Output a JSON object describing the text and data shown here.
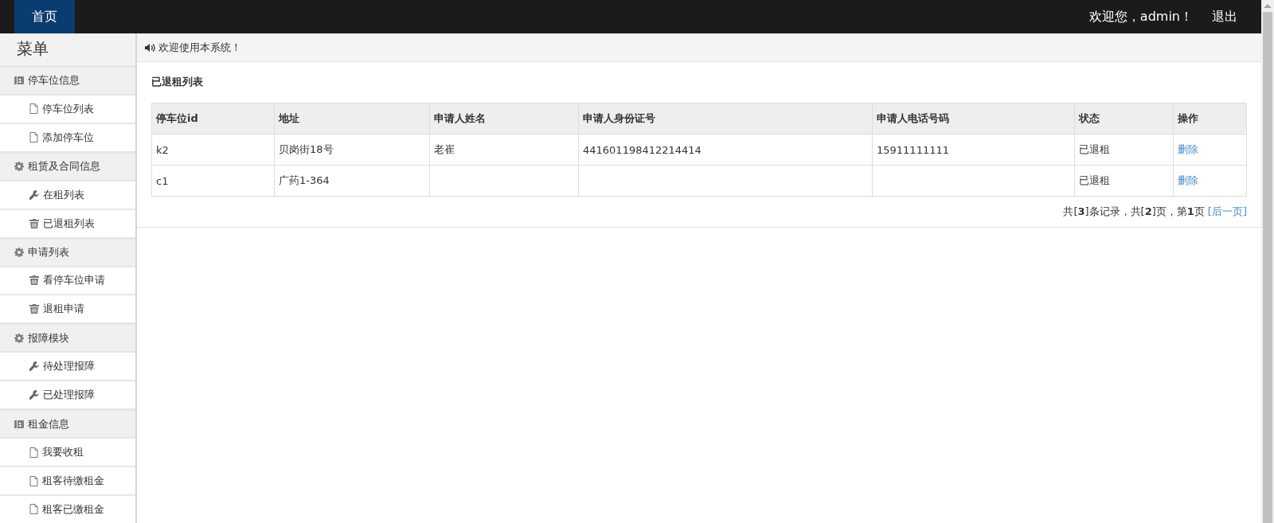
{
  "nav": {
    "home": "首页",
    "welcome": "欢迎您，admin！",
    "logout": "退出"
  },
  "sidebar": {
    "title": "菜单",
    "groups": [
      {
        "label": "停车位信息",
        "kind": "card",
        "items": [
          {
            "label": "停车位列表",
            "kind": "file"
          },
          {
            "label": "添加停车位",
            "kind": "file"
          }
        ]
      },
      {
        "label": "租赁及合同信息",
        "kind": "gear",
        "items": [
          {
            "label": "在租列表",
            "kind": "wrench"
          },
          {
            "label": "已退租列表",
            "kind": "trash"
          }
        ]
      },
      {
        "label": "申请列表",
        "kind": "gear",
        "items": [
          {
            "label": "看停车位申请",
            "kind": "trash"
          },
          {
            "label": "退租申请",
            "kind": "trash"
          }
        ]
      },
      {
        "label": "报障模块",
        "kind": "gear",
        "items": [
          {
            "label": "待处理报障",
            "kind": "wrench"
          },
          {
            "label": "已处理报障",
            "kind": "wrench"
          }
        ]
      },
      {
        "label": "租金信息",
        "kind": "card",
        "items": [
          {
            "label": "我要收租",
            "kind": "file"
          },
          {
            "label": "租客待缴租金",
            "kind": "file"
          },
          {
            "label": "租客已缴租金",
            "kind": "file"
          }
        ]
      }
    ]
  },
  "notice": "欢迎使用本系统！",
  "section_title": "已退租列表",
  "table": {
    "columns": [
      "停车位id",
      "地址",
      "申请人姓名",
      "申请人身份证号",
      "申请人电话号码",
      "状态",
      "操作"
    ],
    "rows": [
      {
        "cells": [
          "k2",
          "贝岗街18号",
          "老崔",
          "441601198412214414",
          "15911111111",
          "已退租"
        ],
        "action": "删除"
      },
      {
        "cells": [
          "c1",
          "广药1-364",
          "",
          "",
          "",
          "已退租"
        ],
        "action": "删除"
      }
    ]
  },
  "pagination": {
    "summary": "共[**3**]条记录，共[**2**]页，第**1**页",
    "next": "[后一页]"
  }
}
